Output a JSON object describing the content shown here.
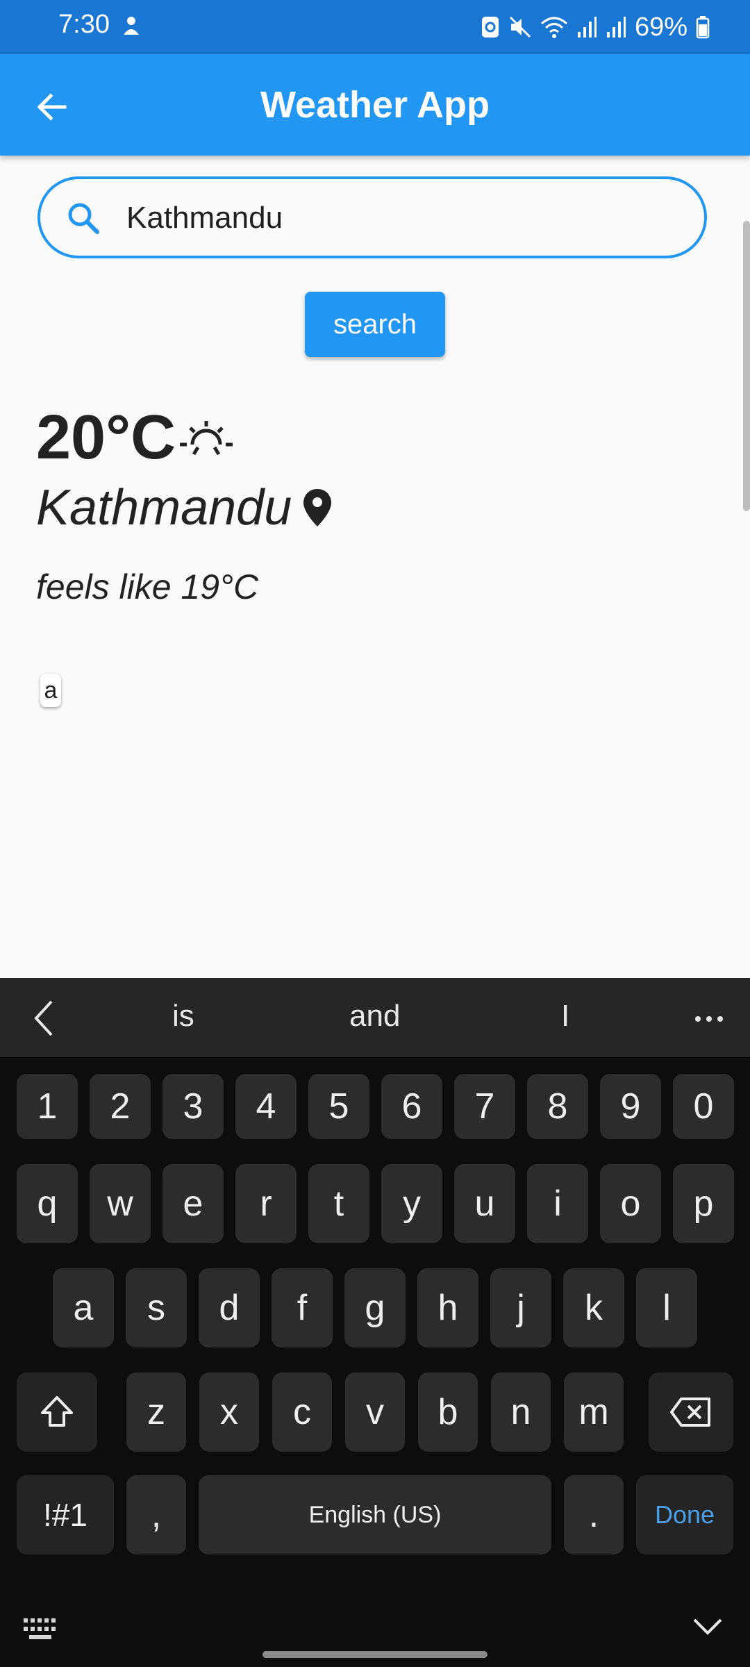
{
  "status_bar": {
    "time": "7:30",
    "battery": "69%"
  },
  "app_bar": {
    "title": "Weather App",
    "back_icon": "arrow-back-icon"
  },
  "search": {
    "value": "Kathmandu",
    "icon": "search-icon",
    "button_label": "search"
  },
  "weather": {
    "temperature": "20°C",
    "condition_icon": "sunrise-icon",
    "city": "Kathmandu",
    "location_icon": "location-pin-icon",
    "feels_like": "feels like 19°C"
  },
  "floating_chip": "a",
  "keyboard": {
    "suggestions": [
      "is",
      "and",
      "I"
    ],
    "number_row": [
      "1",
      "2",
      "3",
      "4",
      "5",
      "6",
      "7",
      "8",
      "9",
      "0"
    ],
    "row1": [
      "q",
      "w",
      "e",
      "r",
      "t",
      "y",
      "u",
      "i",
      "o",
      "p"
    ],
    "row2": [
      "a",
      "s",
      "d",
      "f",
      "g",
      "h",
      "j",
      "k",
      "l"
    ],
    "row3": [
      "z",
      "x",
      "c",
      "v",
      "b",
      "n",
      "m"
    ],
    "symbols_label": "!#1",
    "comma_label": ",",
    "space_label": "English (US)",
    "period_label": ".",
    "done_label": "Done"
  },
  "colors": {
    "status_bar": "#1976d2",
    "app_bar": "#2196f3",
    "accent": "#2196f3",
    "keyboard_bg": "#0d0d0d",
    "key_bg": "#2c2c2c"
  }
}
